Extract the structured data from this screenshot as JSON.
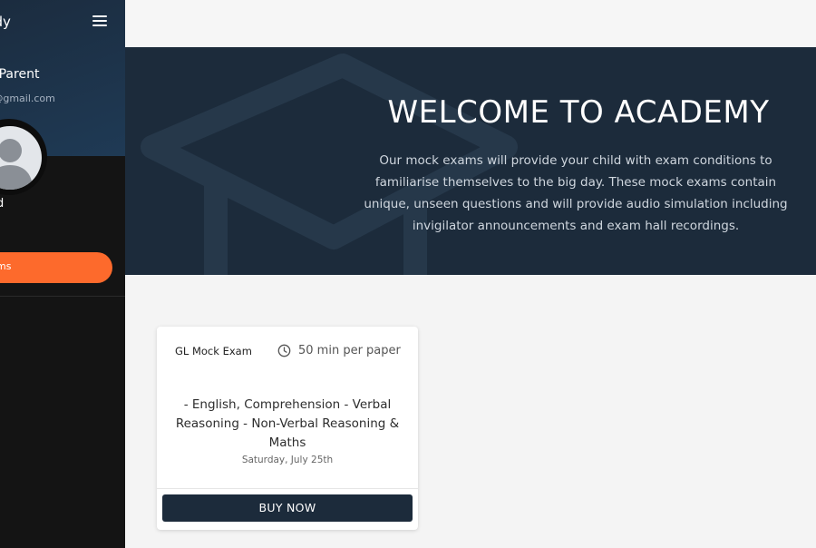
{
  "sidebar": {
    "brand": "ddy",
    "user_name": "us Parent",
    "user_email": "rent@gmail.com",
    "role": "d",
    "nav_items": [
      {
        "label": "ms",
        "active": true
      }
    ]
  },
  "hero": {
    "title": "WELCOME TO ACADEMY",
    "text": "Our mock exams will provide your child with exam conditions to familiarise themselves to the big day. These mock exams contain unique, unseen questions and will provide audio simulation including invigilator announcements and exam hall recordings."
  },
  "exams": [
    {
      "title": "GL Mock Exam",
      "duration": "50 min per paper",
      "subjects": "- English, Comprehension - Verbal Reasoning - Non-Verbal Reasoning & Maths",
      "date": "Saturday, July 25th",
      "button_label": "BUY NOW"
    }
  ],
  "colors": {
    "primary": "#1c2b3b",
    "accent": "#fd6a2c",
    "sidebar_bg": "#141414"
  },
  "icons": {
    "menu": "hamburger-icon",
    "avatar": "user-silhouette",
    "clock": "clock-icon"
  }
}
